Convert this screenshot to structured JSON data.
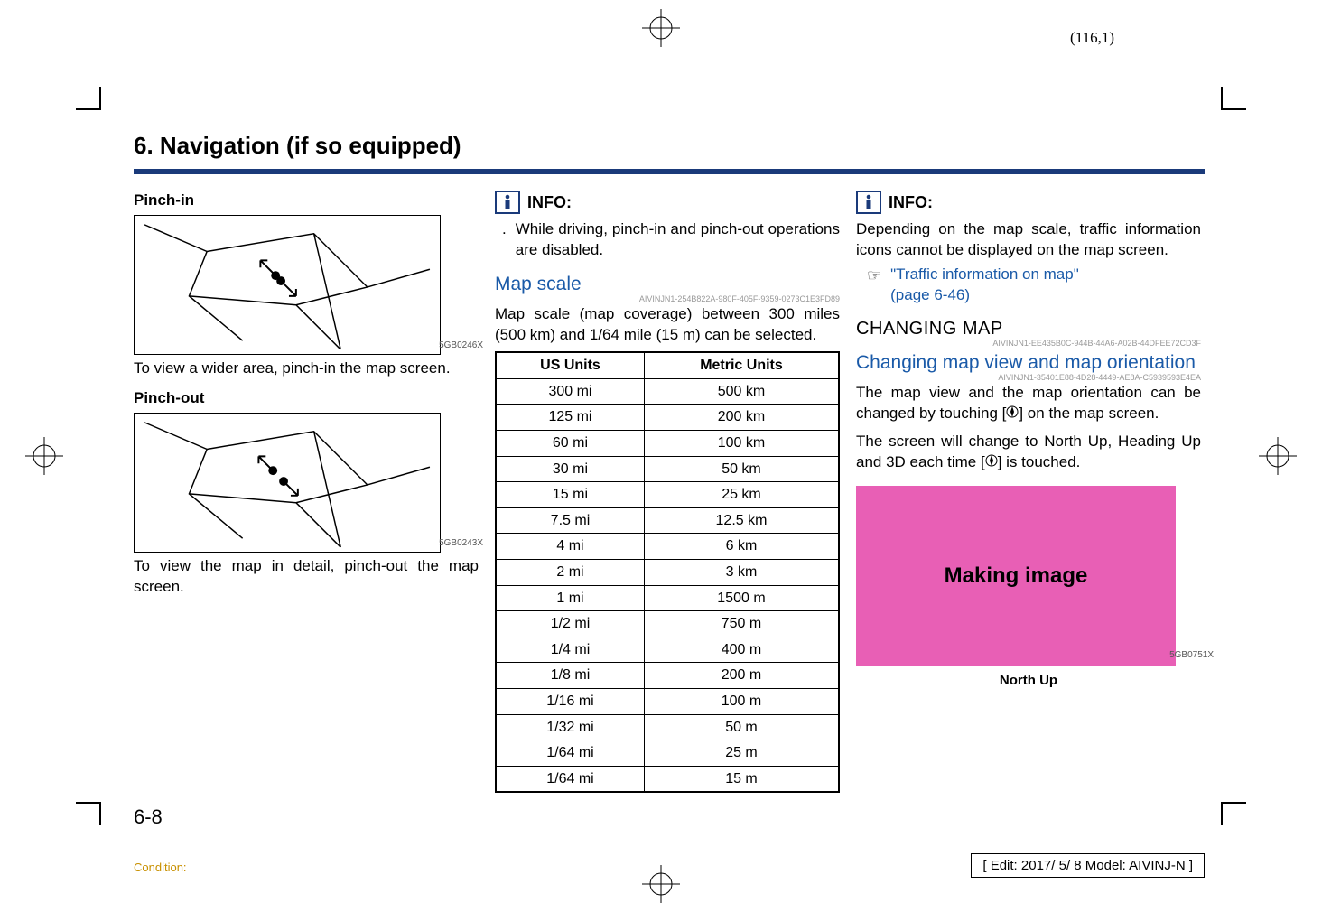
{
  "page_num_top": "(116,1)",
  "chapter_title": "6. Navigation (if so equipped)",
  "col1": {
    "sub1": "Pinch-in",
    "illus1_code": "5GB0246X",
    "p1": "To view a wider area, pinch-in the map screen.",
    "sub2": "Pinch-out",
    "illus2_code": "5GB0243X",
    "p2": "To view the map in detail, pinch-out the map screen."
  },
  "col2": {
    "info_label": "INFO:",
    "bullet1": "While driving, pinch-in and pinch-out operations are disabled.",
    "head1": "Map scale",
    "code1": "AIVINJN1-254B822A-980F-405F-9359-0273C1E3FD89",
    "p1": "Map scale (map coverage) between 300 miles (500 km) and 1/64 mile (15 m) can be selected.",
    "table": {
      "h1": "US Units",
      "h2": "Metric Units",
      "rows": [
        [
          "300 mi",
          "500 km"
        ],
        [
          "125 mi",
          "200 km"
        ],
        [
          "60 mi",
          "100 km"
        ],
        [
          "30 mi",
          "50 km"
        ],
        [
          "15 mi",
          "25 km"
        ],
        [
          "7.5 mi",
          "12.5 km"
        ],
        [
          "4 mi",
          "6 km"
        ],
        [
          "2 mi",
          "3 km"
        ],
        [
          "1 mi",
          "1500 m"
        ],
        [
          "1/2 mi",
          "750 m"
        ],
        [
          "1/4 mi",
          "400 m"
        ],
        [
          "1/8 mi",
          "200 m"
        ],
        [
          "1/16 mi",
          "100 m"
        ],
        [
          "1/32 mi",
          "50 m"
        ],
        [
          "1/64 mi",
          "25 m"
        ],
        [
          "1/64 mi",
          "15 m"
        ]
      ]
    }
  },
  "col3": {
    "info_label": "INFO:",
    "p1": "Depending on the map scale, traffic information icons cannot be displayed on the map screen.",
    "xref1a": "\"Traffic information on map\"",
    "xref1b": "(page 6-46)",
    "head1": "CHANGING MAP",
    "code1": "AIVINJN1-EE435B0C-944B-44A6-A02B-44DFEE72CD3F",
    "head2": "Changing map view and map orientation",
    "code2": "AIVINJN1-35401E88-4D28-4449-AE8A-C5939593E4EA",
    "p2a": "The map view and the map orientation can be changed by touching [",
    "p2b": "] on the map screen.",
    "p3a": "The screen will change to North Up, Heading Up and 3D each time [",
    "p3b": "] is touched.",
    "making": "Making image",
    "making_code": "5GB0751X",
    "caption": "North Up"
  },
  "page_num_bottom": "6-8",
  "condition": "Condition:",
  "edit_box": "[ Edit: 2017/ 5/ 8   Model: AIVINJ-N ]"
}
